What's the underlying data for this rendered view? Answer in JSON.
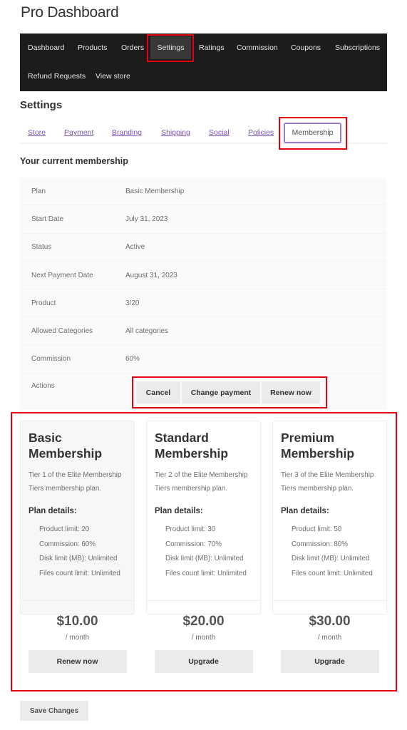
{
  "page": {
    "title": "Pro Dashboard"
  },
  "topnav": {
    "items": [
      {
        "label": "Dashboard"
      },
      {
        "label": "Products"
      },
      {
        "label": "Orders"
      },
      {
        "label": "Settings",
        "active": true
      },
      {
        "label": "Ratings"
      },
      {
        "label": "Commission"
      },
      {
        "label": "Coupons"
      },
      {
        "label": "Subscriptions"
      },
      {
        "label": "Refund Requests"
      },
      {
        "label": "View store"
      }
    ]
  },
  "settings": {
    "heading": "Settings",
    "tabs": [
      {
        "label": "Store"
      },
      {
        "label": "Payment"
      },
      {
        "label": "Branding"
      },
      {
        "label": "Shipping"
      },
      {
        "label": "Social"
      },
      {
        "label": "Policies"
      },
      {
        "label": "Membership",
        "active": true
      }
    ]
  },
  "membership": {
    "heading": "Your current membership",
    "rows": [
      {
        "key": "Plan",
        "value": "Basic Membership"
      },
      {
        "key": "Start Date",
        "value": "July 31, 2023"
      },
      {
        "key": "Status",
        "value": "Active"
      },
      {
        "key": "Next Payment Date",
        "value": "August 31, 2023"
      },
      {
        "key": "Product",
        "value": "3/20"
      },
      {
        "key": "Allowed Categories",
        "value": "All categories"
      },
      {
        "key": "Commission",
        "value": "60%"
      }
    ],
    "actions_label": "Actions",
    "actions": [
      {
        "label": "Cancel"
      },
      {
        "label": "Change payment"
      },
      {
        "label": "Renew now"
      }
    ]
  },
  "plans": [
    {
      "name": "Basic Membership",
      "description": "Tier 1 of the Elite Membership Tiers membership plan.",
      "details_heading": "Plan details:",
      "details": [
        "Product limit: 20",
        "Commission: 60%",
        "Disk limit (MB): Unlimited",
        "Files count limit: Unlimited"
      ],
      "price": "$10.00",
      "period": "/ month",
      "button": "Renew now",
      "current": true
    },
    {
      "name": "Standard Membership",
      "description": "Tier 2 of the Elite Membership Tiers membership plan.",
      "details_heading": "Plan details:",
      "details": [
        "Product limit: 30",
        "Commission: 70%",
        "Disk limit (MB): Unlimited",
        "Files count limit: Unlimited"
      ],
      "price": "$20.00",
      "period": "/ month",
      "button": "Upgrade",
      "current": false
    },
    {
      "name": "Premium Membership",
      "description": "Tier 3 of the Elite Membership Tiers membership plan.",
      "details_heading": "Plan details:",
      "details": [
        "Product limit: 50",
        "Commission: 80%",
        "Disk limit (MB): Unlimited",
        "Files count limit: Unlimited"
      ],
      "price": "$30.00",
      "period": "/ month",
      "button": "Upgrade",
      "current": false
    }
  ],
  "footer": {
    "save_label": "Save Changes"
  },
  "colors": {
    "accent": "#7f54b3",
    "nav_bg": "#1c1c1c",
    "highlight": "#e3000f"
  }
}
